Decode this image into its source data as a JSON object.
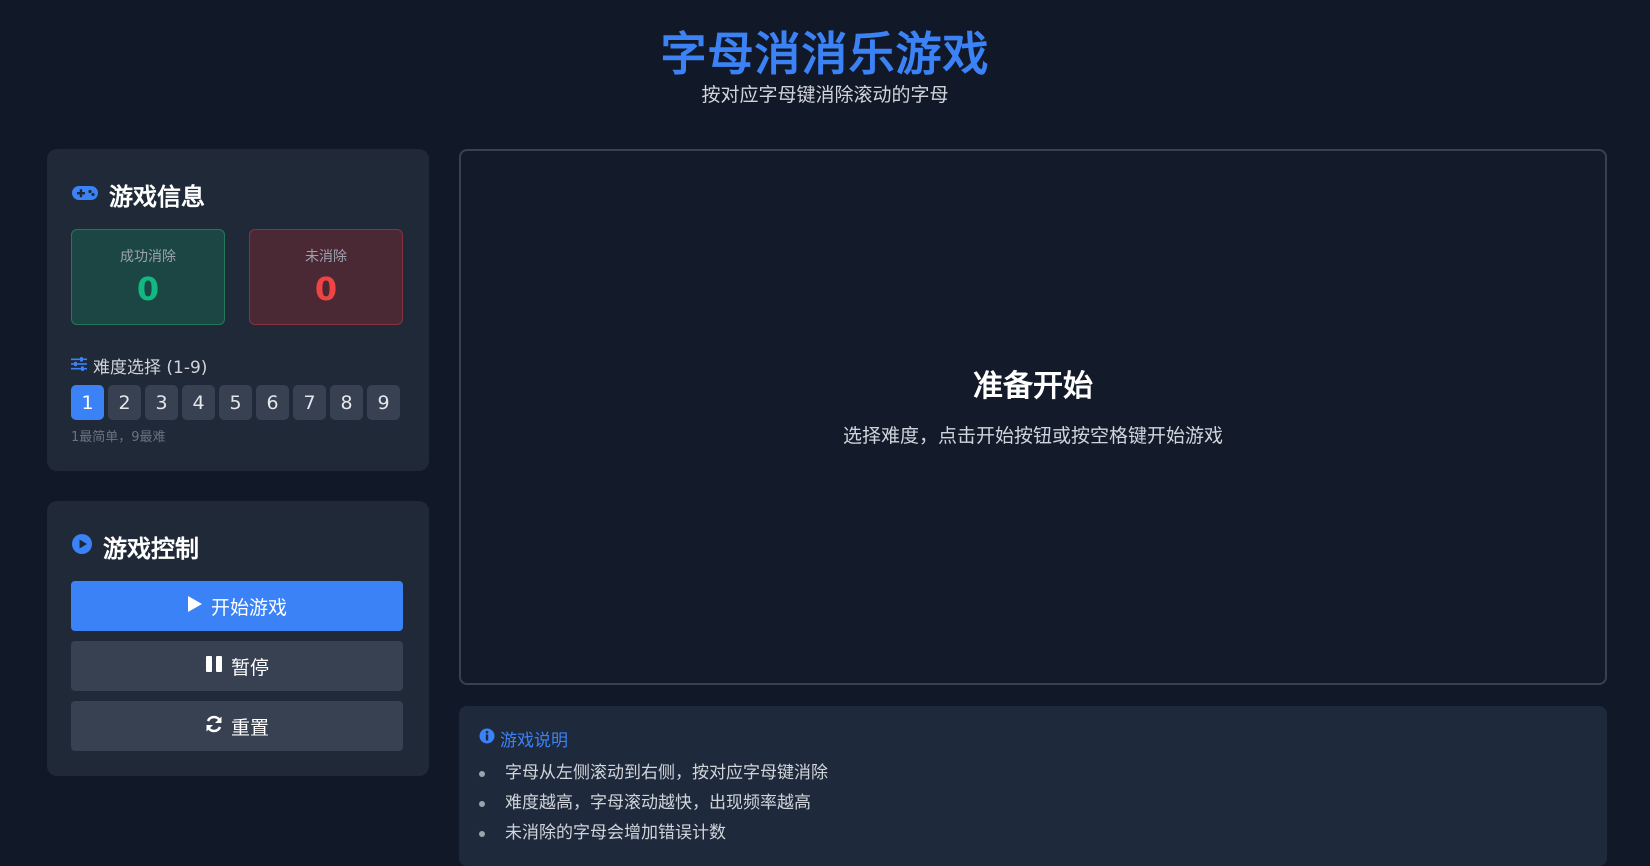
{
  "header": {
    "title": "字母消消乐游戏",
    "subtitle": "按对应字母键消除滚动的字母"
  },
  "info_panel": {
    "title": "游戏信息",
    "icon": "gamepad-icon",
    "success": {
      "label": "成功消除",
      "value": "0"
    },
    "missed": {
      "label": "未消除",
      "value": "0"
    },
    "difficulty": {
      "label": "难度选择 (1-9)",
      "icon": "sliders-icon",
      "options": [
        "1",
        "2",
        "3",
        "4",
        "5",
        "6",
        "7",
        "8",
        "9"
      ],
      "selected": "1",
      "hint": "1最简单，9最难"
    }
  },
  "control_panel": {
    "title": "游戏控制",
    "icon": "play-circle-icon",
    "start_label": "开始游戏",
    "pause_label": "暂停",
    "reset_label": "重置"
  },
  "game_area": {
    "ready_title": "准备开始",
    "ready_subtitle": "选择难度，点击开始按钮或按空格键开始游戏"
  },
  "instructions": {
    "title": "游戏说明",
    "icon": "info-circle-icon",
    "items": [
      "字母从左侧滚动到右侧，按对应字母键消除",
      "难度越高，字母滚动越快，出现频率越高",
      "未消除的字母会增加错误计数"
    ]
  },
  "colors": {
    "accent": "#3b82f6",
    "success": "#10b981",
    "danger": "#ef4444",
    "background": "#111827",
    "panel": "#1f2937"
  }
}
